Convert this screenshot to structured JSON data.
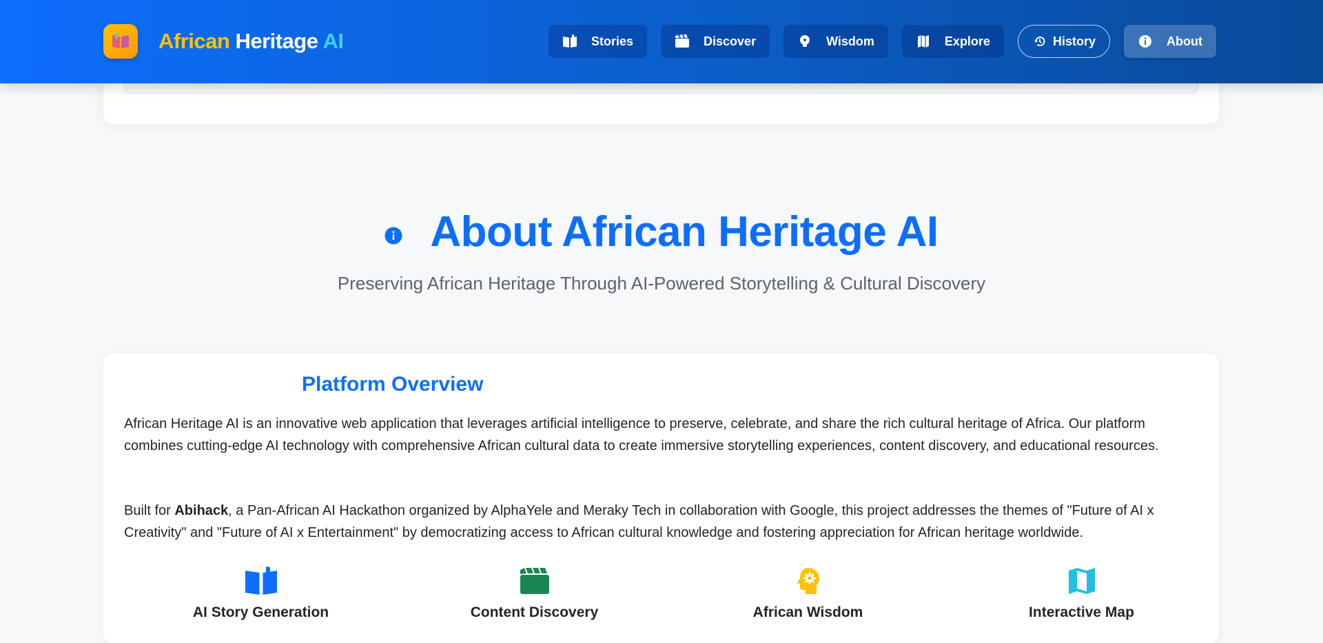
{
  "brand": {
    "part1": "African",
    "part2": "Heritage",
    "part3": "AI"
  },
  "nav": {
    "items": [
      {
        "label": "Stories",
        "icon": "book-icon"
      },
      {
        "label": "Discover",
        "icon": "film-icon"
      },
      {
        "label": "Wisdom",
        "icon": "lightbulb-icon"
      },
      {
        "label": "Explore",
        "icon": "map-icon"
      },
      {
        "label": "History",
        "icon": "history-icon"
      },
      {
        "label": "About",
        "icon": "info-icon",
        "active": true
      }
    ]
  },
  "hero": {
    "title": "About African Heritage AI",
    "subtitle": "Preserving African Heritage Through AI-Powered Storytelling & Cultural Discovery"
  },
  "overview": {
    "title": "Platform Overview",
    "paragraph1": "African Heritage AI is an innovative web application that leverages artificial intelligence to preserve, celebrate, and share the rich cultural heritage of Africa. Our platform combines cutting-edge AI technology with comprehensive African cultural data to create immersive storytelling experiences, content discovery, and educational resources.",
    "paragraph2_prefix": "Built for ",
    "paragraph2_bold": "Abihack",
    "paragraph2_rest": ", a Pan-African AI Hackathon organized by AlphaYele and Meraky Tech in collaboration with Google, this project addresses the themes of \"Future of AI x Creativity\" and \"Future of AI x Entertainment\" by democratizing access to African cultural knowledge and fostering appreciation for African heritage worldwide."
  },
  "features": [
    {
      "title": "AI Story Generation",
      "icon": "book-icon",
      "color": "#0d6efd"
    },
    {
      "title": "Content Discovery",
      "icon": "film-icon",
      "color": "#198754"
    },
    {
      "title": "African Wisdom",
      "icon": "head-gear-icon",
      "color": "#ffc107"
    },
    {
      "title": "Interactive Map",
      "icon": "map-icon",
      "color": "#20c0e0"
    }
  ],
  "colors": {
    "primary": "#0d6efd",
    "accent_yellow": "#ffc107",
    "accent_cyan": "#3ecff0",
    "success": "#198754"
  }
}
